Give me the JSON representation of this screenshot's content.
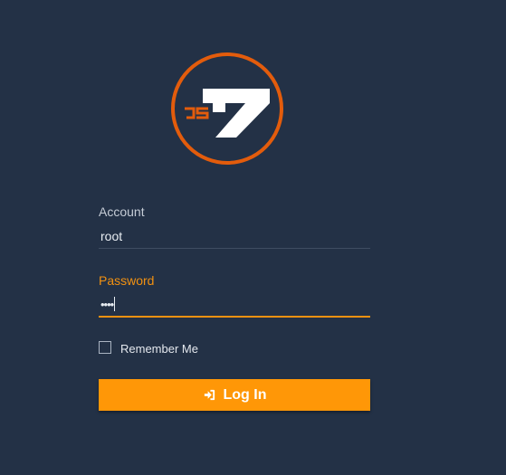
{
  "logo": {
    "text": "JS7",
    "ring_color": "#e35c0c",
    "letter_color": "#e35c0c",
    "mark_color": "#ffffff"
  },
  "form": {
    "account": {
      "label": "Account",
      "value": "root"
    },
    "password": {
      "label": "Password",
      "masked_value": "••••"
    },
    "remember_me": {
      "label": "Remember Me",
      "checked": false
    },
    "login_button": {
      "label": "Log In",
      "icon": "sign-in-icon"
    }
  },
  "colors": {
    "background": "#233146",
    "accent": "#ff9707",
    "label_active": "#f29111"
  }
}
